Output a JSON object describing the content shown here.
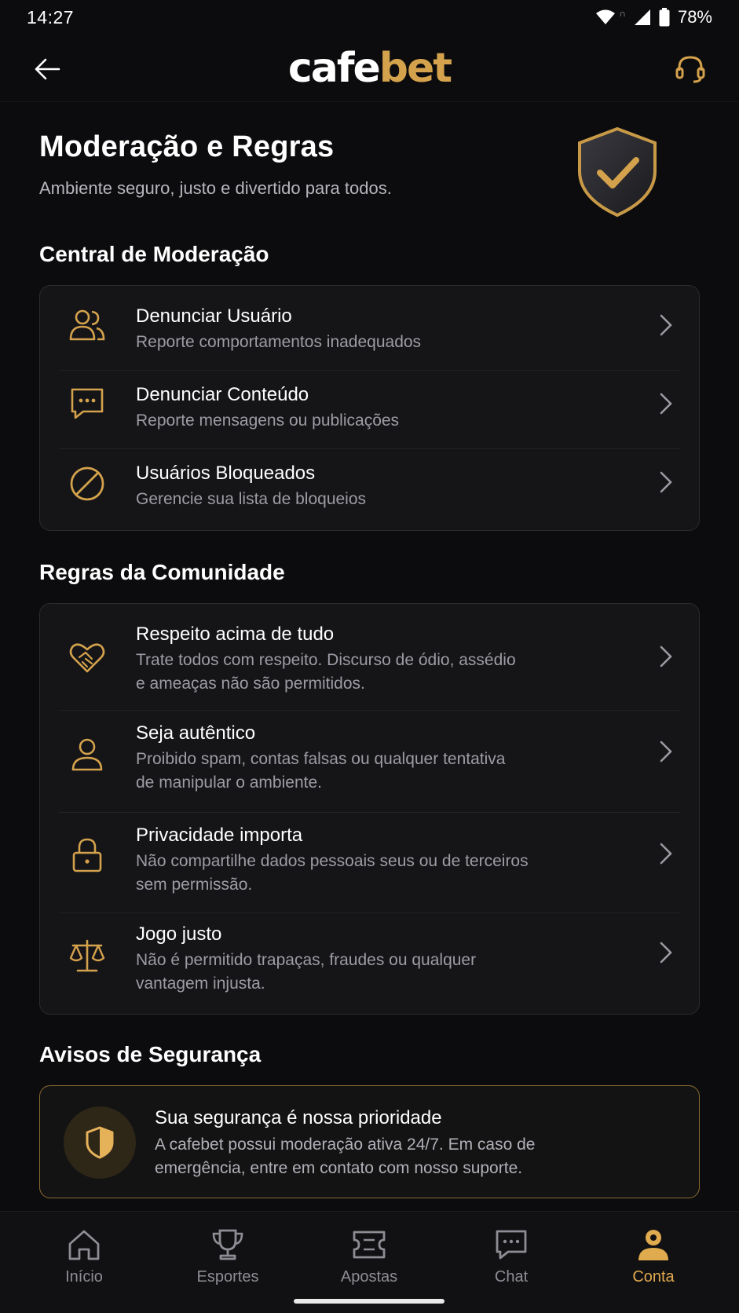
{
  "status_bar": {
    "time": "14:27",
    "battery": "78%"
  },
  "header": {
    "logo_part1": "cafe",
    "logo_part2": "bet",
    "back_icon": "arrow-left-icon",
    "support_icon": "headset-icon"
  },
  "page": {
    "title": "Moderação e Regras",
    "subtitle": "Ambiente seguro, justo e divertido para todos."
  },
  "moderation": {
    "section_title": "Central de Moderação",
    "items": [
      {
        "title": "Denunciar Usuário",
        "description": "Reporte comportamentos inadequados",
        "icon": "users-icon"
      },
      {
        "title": "Denunciar Conteúdo",
        "description": "Reporte mensagens ou publicações",
        "icon": "message-icon"
      },
      {
        "title": "Usuários Bloqueados",
        "description": "Gerencie sua lista de bloqueios",
        "icon": "block-icon"
      }
    ]
  },
  "rules": {
    "section_title": "Regras da Comunidade",
    "items": [
      {
        "title": "Respeito acima de tudo",
        "description_line1": "Trate todos com respeito. Discurso de ódio, assédio",
        "description_line2": "e ameaças não são permitidos.",
        "icon": "handshake-heart-icon"
      },
      {
        "title": "Seja autêntico",
        "description_line1": "Proibido spam, contas falsas ou qualquer tentativa",
        "description_line2": "de manipular o ambiente.",
        "icon": "user-icon"
      },
      {
        "title": "Privacidade importa",
        "description_line1": "Não compartilhe dados pessoais seus ou de terceiros",
        "description_line2": "sem permissão.",
        "icon": "lock-icon"
      },
      {
        "title": "Jogo justo",
        "description_line1": "Não é permitido trapaças, fraudes ou qualquer",
        "description_line2": "vantagem injusta.",
        "icon": "scale-icon"
      }
    ]
  },
  "safety": {
    "section_title": "Avisos de Segurança",
    "notice_title": "Sua segurança é nossa prioridade",
    "notice_line1": "A cafebet possui moderação ativa 24/7. Em caso de",
    "notice_line2": "emergência, entre em contato com nosso suporte.",
    "icon": "shield-icon"
  },
  "bottom_nav": {
    "items": [
      {
        "label": "Início",
        "icon": "home-icon"
      },
      {
        "label": "Esportes",
        "icon": "trophy-icon"
      },
      {
        "label": "Apostas",
        "icon": "ticket-icon"
      },
      {
        "label": "Chat",
        "icon": "chat-icon"
      },
      {
        "label": "Conta",
        "icon": "account-icon"
      }
    ],
    "active": "Conta"
  },
  "colors": {
    "accent": "#d4a24c",
    "background": "#0c0c0e",
    "card": "#151518"
  }
}
